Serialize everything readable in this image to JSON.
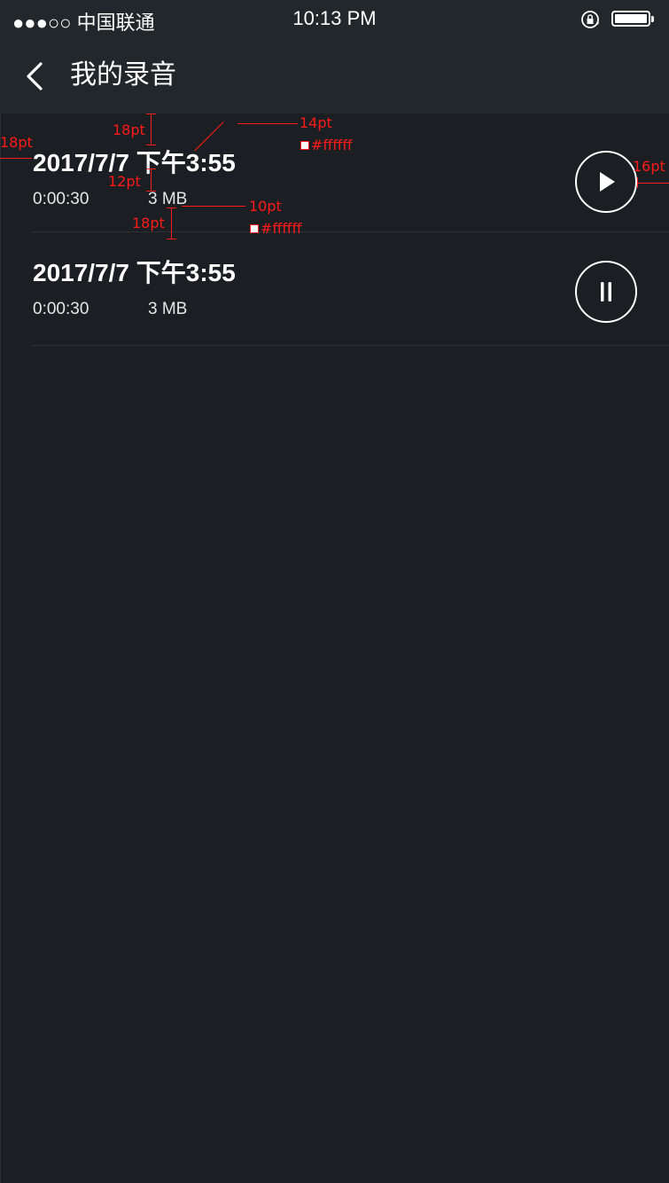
{
  "status_bar": {
    "signal": "●●●○○",
    "carrier": "中国联通",
    "time": "10:13 PM"
  },
  "nav": {
    "title": "我的录音"
  },
  "recordings": [
    {
      "title": "2017/7/7  下午3:55",
      "duration": "0:00:30",
      "size": "3 MB",
      "control": "play-icon"
    },
    {
      "title": "2017/7/7  下午3:55",
      "duration": "0:00:30",
      "size": "3 MB",
      "control": "pause-icon"
    }
  ],
  "annotations": {
    "left_margin": "18pt",
    "top_gap": "18pt",
    "title_font_size": "14pt",
    "title_color": "#ffffff",
    "title_meta_gap": "12pt",
    "meta_font_size": "10pt",
    "meta_color": "#ffffff",
    "bottom_gap": "18pt",
    "right_margin": "16pt"
  },
  "colors": {
    "background": "#1b1e22",
    "header": "#22272b",
    "annotation": "#ff1a1a",
    "text": "#ffffff"
  }
}
